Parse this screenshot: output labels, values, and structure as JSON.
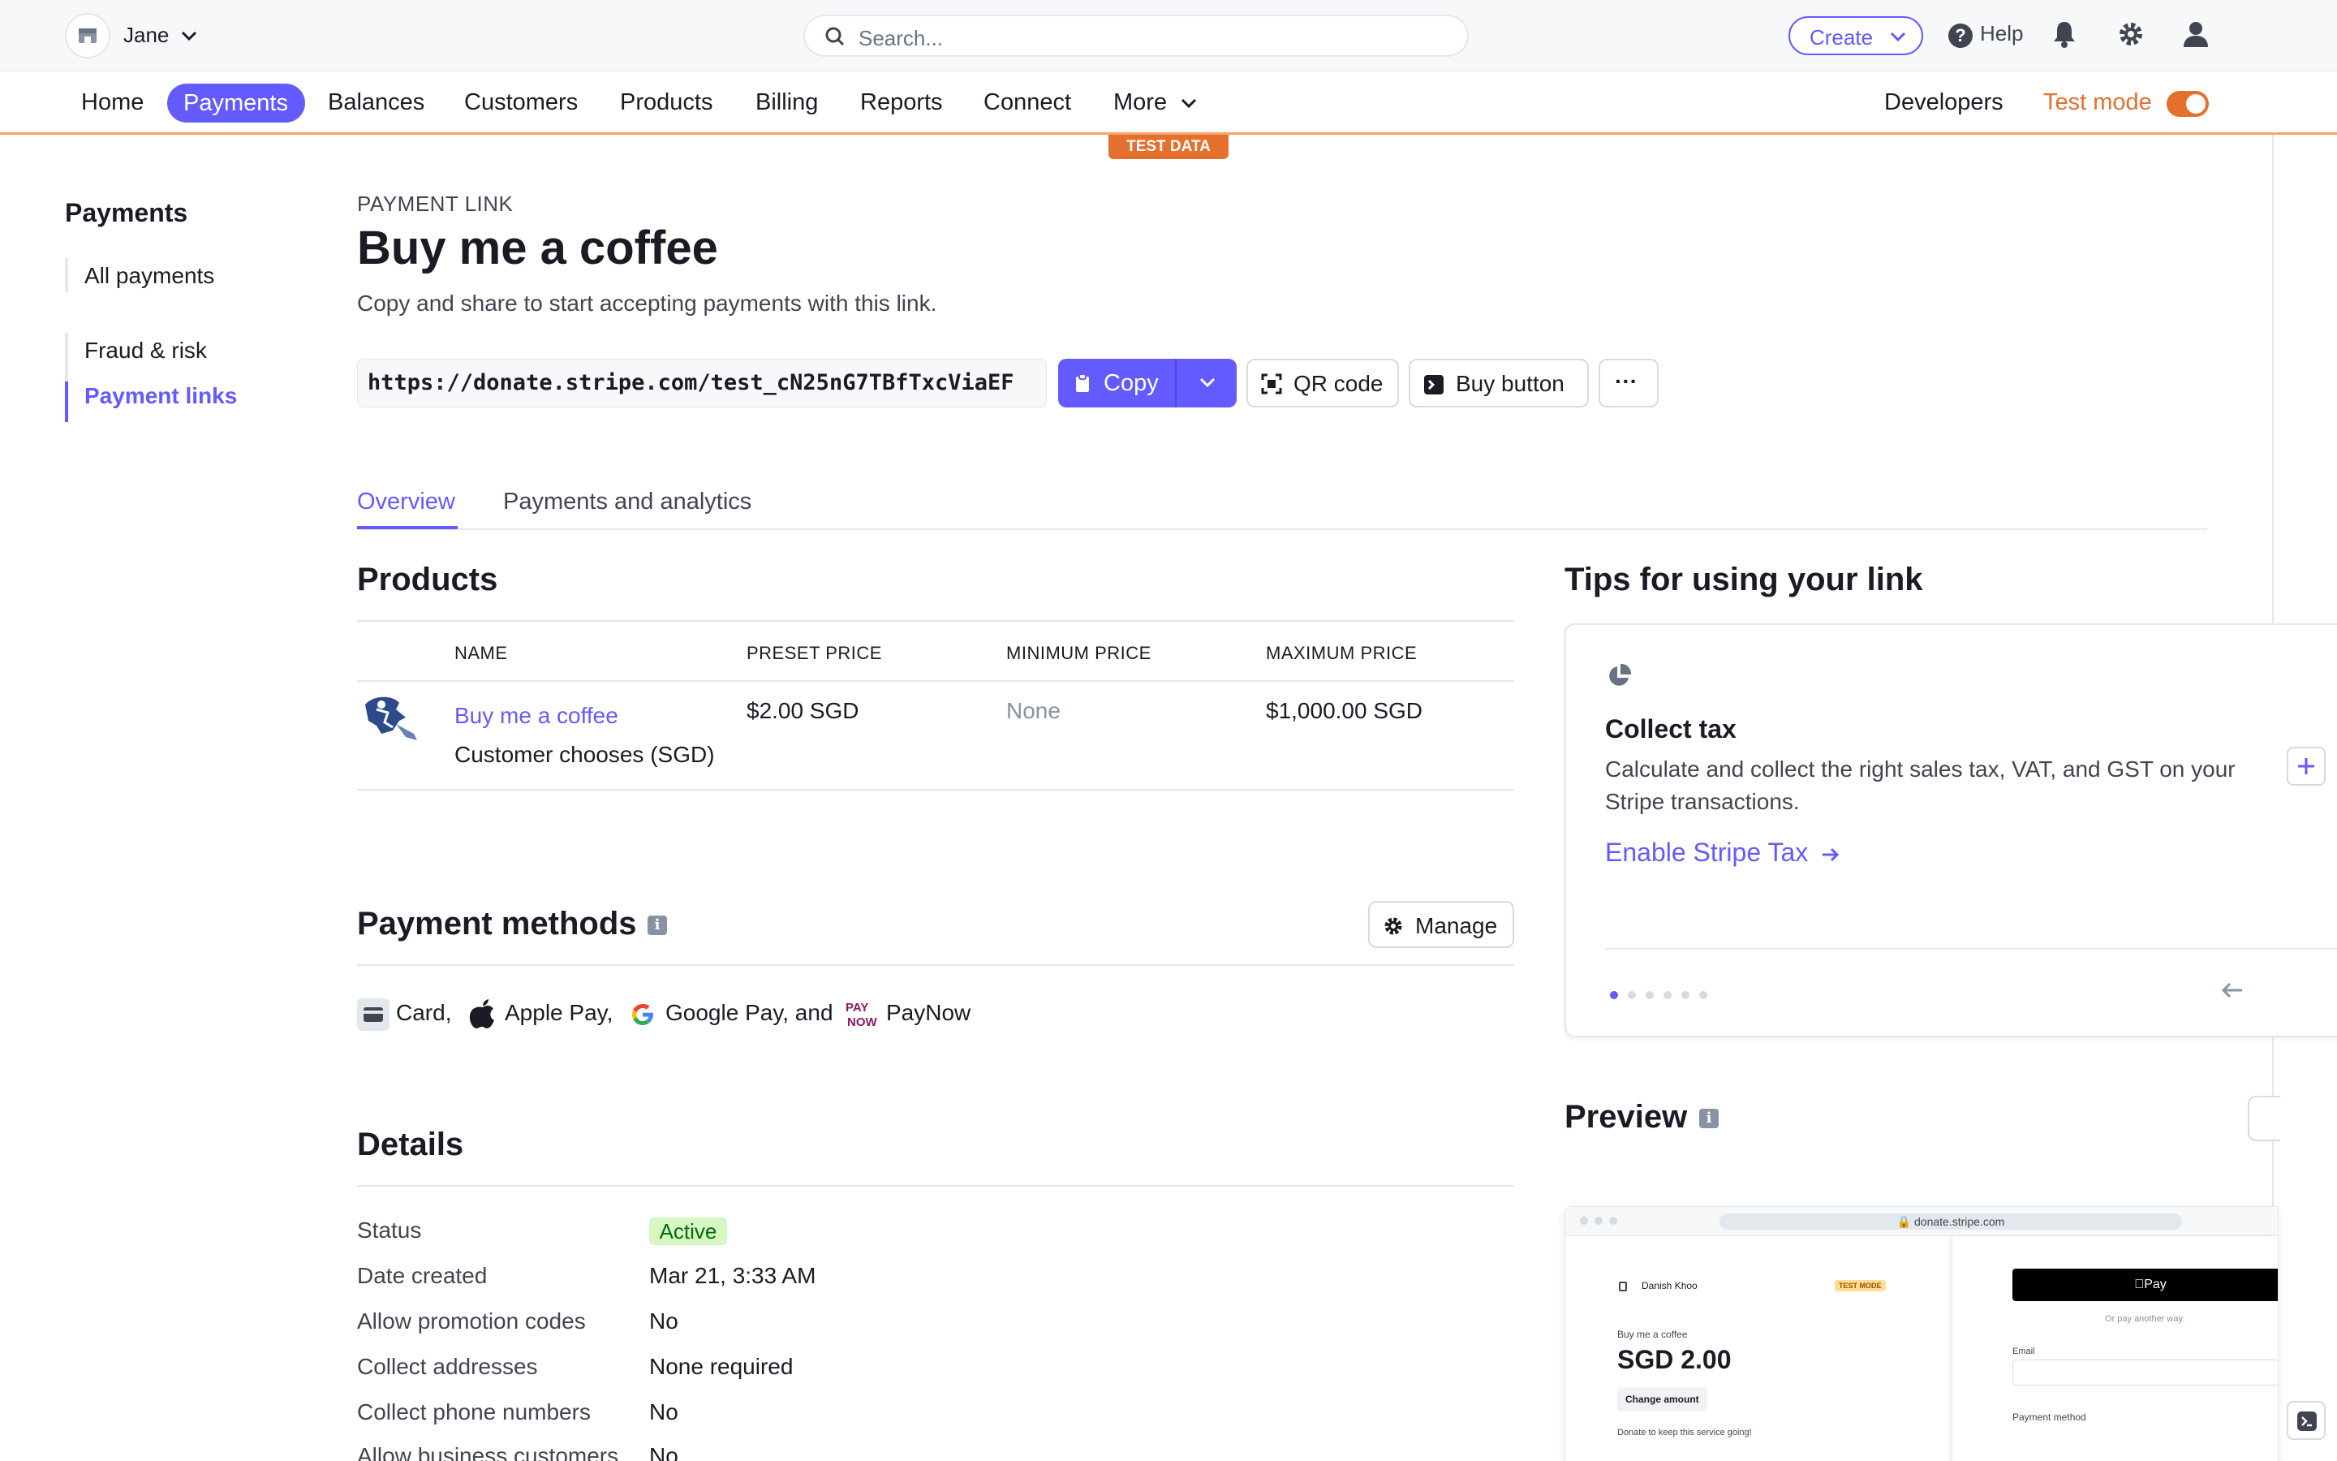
{
  "topbar": {
    "account_name": "Jane",
    "search_placeholder": "Search...",
    "create_label": "Create",
    "help_label": "Help"
  },
  "nav": {
    "items": [
      "Home",
      "Payments",
      "Balances",
      "Customers",
      "Products",
      "Billing",
      "Reports",
      "Connect",
      "More"
    ],
    "active": "Payments",
    "developers": "Developers",
    "test_mode": "Test mode",
    "test_mode_on": true,
    "test_data_badge": "TEST DATA"
  },
  "sidebar": {
    "title": "Payments",
    "items": [
      "All payments",
      "Fraud & risk",
      "Payment links"
    ],
    "active": "Payment links"
  },
  "header": {
    "eyebrow": "PAYMENT LINK",
    "title": "Buy me a coffee",
    "subtitle": "Copy and share to start accepting payments with this link.",
    "url": "https://donate.stripe.com/test_cN25nG7TBfTxcViaEF",
    "copy_label": "Copy",
    "qr_label": "QR code",
    "buy_button_label": "Buy button",
    "more_label": "···"
  },
  "tabs": [
    "Overview",
    "Payments and analytics"
  ],
  "products": {
    "title": "Products",
    "columns": [
      "NAME",
      "PRESET PRICE",
      "MINIMUM PRICE",
      "MAXIMUM PRICE"
    ],
    "rows": [
      {
        "name": "Buy me a coffee",
        "subtitle": "Customer chooses (SGD)",
        "preset": "$2.00 SGD",
        "minimum": "None",
        "maximum": "$1,000.00 SGD"
      }
    ]
  },
  "payment_methods": {
    "title": "Payment methods",
    "manage_label": "Manage",
    "methods": [
      "Card,",
      "Apple Pay,",
      "Google Pay, and",
      "PayNow"
    ]
  },
  "details": {
    "title": "Details",
    "rows": [
      {
        "label": "Status",
        "value": "Active"
      },
      {
        "label": "Date created",
        "value": "Mar 21, 3:33 AM"
      },
      {
        "label": "Allow promotion codes",
        "value": "No"
      },
      {
        "label": "Collect addresses",
        "value": "None required"
      },
      {
        "label": "Collect phone numbers",
        "value": "No"
      },
      {
        "label": "Allow business customers",
        "value": "No"
      }
    ]
  },
  "tips": {
    "title": "Tips for using your link",
    "card_title": "Collect tax",
    "card_body": "Calculate and collect the right sales tax, VAT, and GST on your Stripe transactions.",
    "card_link": "Enable Stripe Tax",
    "dots_total": 6,
    "dots_active": 1
  },
  "preview": {
    "title": "Preview",
    "domain": "donate.stripe.com",
    "merchant": "Danish Khoo",
    "test_mode_badge": "TEST MODE",
    "item": "Buy me a coffee",
    "amount": "SGD 2.00",
    "change_amount": "Change amount",
    "note": "Donate to keep this service going!",
    "apple_pay": "Pay",
    "or_text": "Or pay another way",
    "email_label": "Email",
    "payment_method_label": "Payment method"
  },
  "colors": {
    "accent": "#635bff",
    "test_mode": "#e56f2d",
    "active_badge_bg": "#d7f7c2",
    "active_badge_text": "#05690d"
  }
}
